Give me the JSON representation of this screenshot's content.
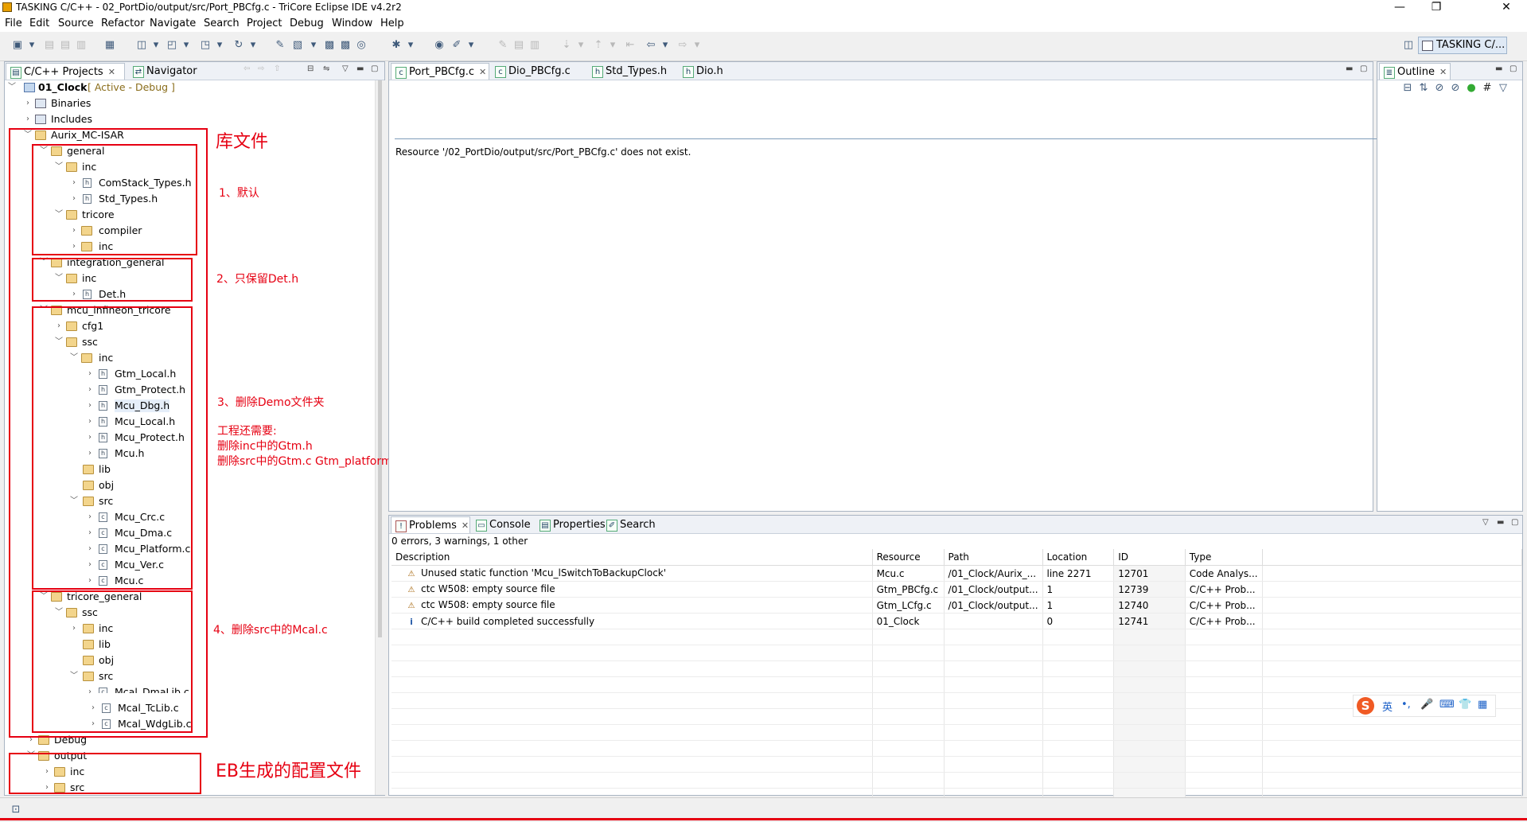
{
  "window": {
    "title": "TASKING C/C++ - 02_PortDio/output/src/Port_PBCfg.c - TriCore Eclipse IDE v4.2r2",
    "minimize": "—",
    "maximize": "❐",
    "close": "✕"
  },
  "menu": [
    "File",
    "Edit",
    "Source",
    "Refactor",
    "Navigate",
    "Search",
    "Project",
    "Debug",
    "Window",
    "Help"
  ],
  "perspective": "TASKING C/...",
  "left_tabs": {
    "projects": "C/C++ Projects",
    "navigator": "Navigator",
    "close": "✕"
  },
  "tree": {
    "project": "01_Clock",
    "project_state": "[ Active - Debug ]",
    "binaries": "Binaries",
    "includes": "Includes",
    "aurix": "Aurix_MC-ISAR",
    "general": "general",
    "inc": "inc",
    "comstack": "ComStack_Types.h",
    "std_types": "Std_Types.h",
    "tricore": "tricore",
    "compiler": "compiler",
    "integration_general": "integration_general",
    "det": "Det.h",
    "mcu_infineon": "mcu_infineon_tricore",
    "cfg1": "cfg1",
    "ssc": "ssc",
    "gtm_local": "Gtm_Local.h",
    "gtm_protect": "Gtm_Protect.h",
    "mcu_dbg": "Mcu_Dbg.h",
    "mcu_local": "Mcu_Local.h",
    "mcu_protect": "Mcu_Protect.h",
    "mcu_h": "Mcu.h",
    "lib": "lib",
    "obj": "obj",
    "src": "src",
    "mcu_crc": "Mcu_Crc.c",
    "mcu_dma": "Mcu_Dma.c",
    "mcu_platform": "Mcu_Platform.c",
    "mcu_ver": "Mcu_Ver.c",
    "mcu_c": "Mcu.c",
    "tricore_general": "tricore_general",
    "mcal_dmalib": "Mcal_DmaLib.c",
    "mcal_tclib": "Mcal_TcLib.c",
    "mcal_wdglib": "Mcal_WdgLib.c",
    "debug": "Debug",
    "output": "output"
  },
  "annotations": {
    "library": "库文件",
    "note1": "1、默认",
    "note2": "2、只保留Det.h",
    "note3": "3、删除Demo文件夹",
    "note3_line1": "工程还需要:",
    "note3_line2": "删除inc中的Gtm.h",
    "note3_line3": "删除src中的Gtm.c Gtm_platform.c",
    "note4": "4、删除src中的Mcal.c",
    "eb_config": "EB生成的配置文件"
  },
  "editor": {
    "tabs": [
      "Port_PBCfg.c",
      "Dio_PBCfg.c",
      "Std_Types.h",
      "Dio.h"
    ],
    "message": "Resource '/02_PortDio/output/src/Port_PBCfg.c' does not exist."
  },
  "outline": {
    "title": "Outline"
  },
  "bottom_tabs": [
    "Problems",
    "Console",
    "Properties",
    "Search"
  ],
  "problems": {
    "summary": "0 errors, 3 warnings, 1 other",
    "columns": [
      "Description",
      "Resource",
      "Path",
      "Location",
      "ID",
      "Type"
    ],
    "rows": [
      {
        "kind": "warning",
        "description": "Unused static function 'Mcu_lSwitchToBackupClock'",
        "resource": "Mcu.c",
        "path": "/01_Clock/Aurix_...",
        "location": "line 2271",
        "id": "12701",
        "type": "Code Analys..."
      },
      {
        "kind": "warning",
        "description": "ctc W508: empty source file",
        "resource": "Gtm_PBCfg.c",
        "path": "/01_Clock/output...",
        "location": "1",
        "id": "12739",
        "type": "C/C++ Prob..."
      },
      {
        "kind": "warning",
        "description": "ctc W508: empty source file",
        "resource": "Gtm_LCfg.c",
        "path": "/01_Clock/output...",
        "location": "1",
        "id": "12740",
        "type": "C/C++ Prob..."
      },
      {
        "kind": "info",
        "description": "C/C++ build completed successfully",
        "resource": "01_Clock",
        "path": "",
        "location": "0",
        "id": "12741",
        "type": "C/C++ Prob..."
      }
    ]
  },
  "ime": {
    "lang": "英",
    "punct": "•,",
    "mic": "🎤",
    "kbd": "⌨",
    "shirt": "👕",
    "grid": "▦"
  },
  "colors": {
    "annotation": "#e60012",
    "panel_border": "#a9b4c2",
    "tab_strip": "#eef1f6"
  }
}
